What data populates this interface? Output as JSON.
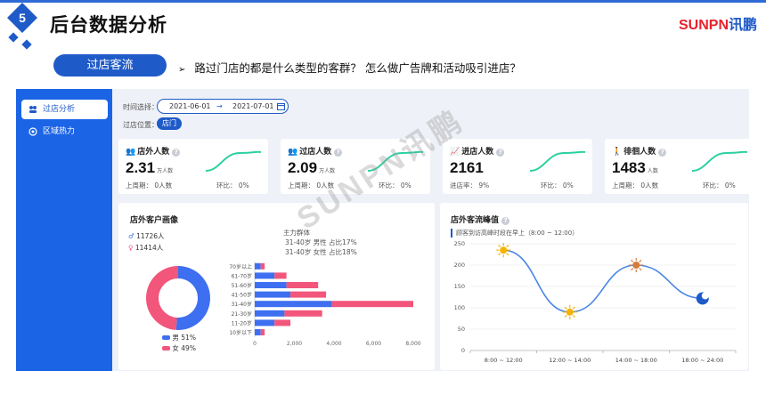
{
  "header": {
    "step_number": "5",
    "title": "后台数据分析",
    "logo_sunpn": "SUNPN",
    "logo_xunpeng": "讯鹏"
  },
  "section": {
    "pill_label": "过店客流",
    "question": "路过门店的都是什么类型的客群？ 怎么做广告牌和活动吸引进店？",
    "arrow": "➢"
  },
  "sidebar": {
    "items": [
      {
        "label": "过店分析",
        "icon": "people-icon",
        "active": true
      },
      {
        "label": "区域热力",
        "icon": "heat-icon",
        "active": false
      }
    ]
  },
  "filters": {
    "time_label": "时间选择：",
    "date_start": "2021-06-01",
    "date_sep": "→",
    "date_end": "2021-07-01",
    "location_label": "过店位置：",
    "location_value": "店门"
  },
  "cards": [
    {
      "title": "店外人数",
      "value": "2.31",
      "unit": "万人数",
      "last_period": "上周期： 0人数",
      "mom": "环比： 0%"
    },
    {
      "title": "过店人数",
      "value": "2.09",
      "unit": "万人数",
      "last_period": "上周期： 0人数",
      "mom": "环比： 0%"
    },
    {
      "title": "进店人数",
      "value": "2161",
      "unit": "",
      "last_period": "进店率： 9%",
      "mom": "环比： 0%"
    },
    {
      "title": "徘徊人数",
      "value": "1483",
      "unit": "人数",
      "last_period": "上周期： 0人数",
      "mom": "环比： 0%"
    }
  ],
  "portrait": {
    "title": "店外客户画像",
    "male_count": "11726人",
    "female_count": "11414人",
    "main_group_label": "主力群体",
    "main_male": "31-40岁 男性 占比17%",
    "main_female": "31-40岁 女性 占比18%",
    "legend_male": "男",
    "legend_female": "女",
    "male_pct": "51%",
    "female_pct": "49%",
    "colors": {
      "male": "#3d6ff0",
      "female": "#f2567b"
    }
  },
  "chart_data": [
    {
      "type": "pie",
      "labels": [
        "男",
        "女"
      ],
      "values": [
        51,
        49
      ]
    },
    {
      "type": "bar",
      "orientation": "horizontal",
      "stacked": true,
      "categories": [
        "70岁以上",
        "61-70岁",
        "51-60岁",
        "41-50岁",
        "31-40岁",
        "21-30岁",
        "11-20岁",
        "10岁以下"
      ],
      "series": [
        {
          "name": "男",
          "values": [
            300,
            1000,
            1600,
            1800,
            3900,
            1500,
            1000,
            300
          ]
        },
        {
          "name": "女",
          "values": [
            200,
            600,
            1600,
            1800,
            4100,
            1900,
            800,
            200
          ]
        }
      ],
      "xlim": [
        0,
        8000
      ],
      "xticks": [
        "0",
        "2,000",
        "4,000",
        "6,000",
        "8,000"
      ]
    },
    {
      "type": "line",
      "title": "店外客流峰值",
      "subtitle": "顾客到访高峰时段在早上（8:00 ~ 12:00）",
      "categories": [
        "8:00 ~ 12:00",
        "12:00 ~ 14:00",
        "14:00 ~ 18:00",
        "18:00 ~ 24:00"
      ],
      "values": [
        235,
        90,
        200,
        122
      ],
      "ylim": [
        0,
        250
      ],
      "yticks": [
        "0",
        "50",
        "100",
        "150",
        "200",
        "250"
      ],
      "color": "#4a86e8"
    }
  ]
}
